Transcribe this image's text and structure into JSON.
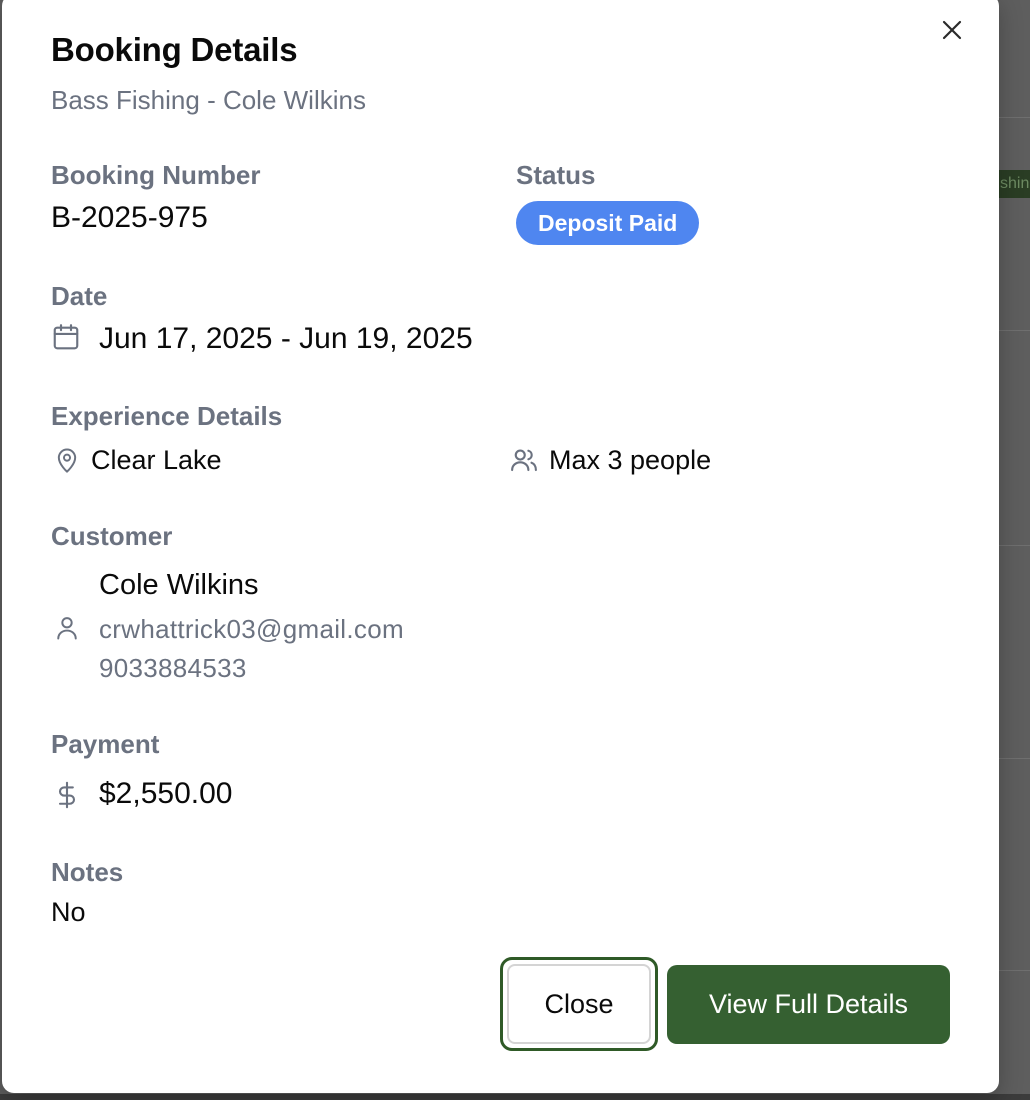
{
  "background": {
    "badge_fragment": "shin"
  },
  "dialog": {
    "title": "Booking Details",
    "subtitle": "Bass Fishing - Cole Wilkins",
    "booking_number": {
      "label": "Booking Number",
      "value": "B-2025-975"
    },
    "status": {
      "label": "Status",
      "value": "Deposit Paid",
      "color": "#4f86f0"
    },
    "date": {
      "label": "Date",
      "value": "Jun 17, 2025 - Jun 19, 2025",
      "icon": "calendar-icon"
    },
    "experience": {
      "label": "Experience Details",
      "location": {
        "value": "Clear Lake",
        "icon": "map-pin-icon"
      },
      "capacity": {
        "value": "Max 3 people",
        "icon": "users-icon"
      }
    },
    "customer": {
      "label": "Customer",
      "name": "Cole Wilkins",
      "email": "crwhattrick03@gmail.com",
      "phone": "9033884533",
      "icon": "user-icon"
    },
    "payment": {
      "label": "Payment",
      "value": "$2,550.00",
      "icon": "dollar-icon"
    },
    "notes": {
      "label": "Notes",
      "value": "No"
    },
    "buttons": {
      "close_label": "Close",
      "view_full_label": "View Full Details",
      "primary_color": "#356031"
    }
  }
}
